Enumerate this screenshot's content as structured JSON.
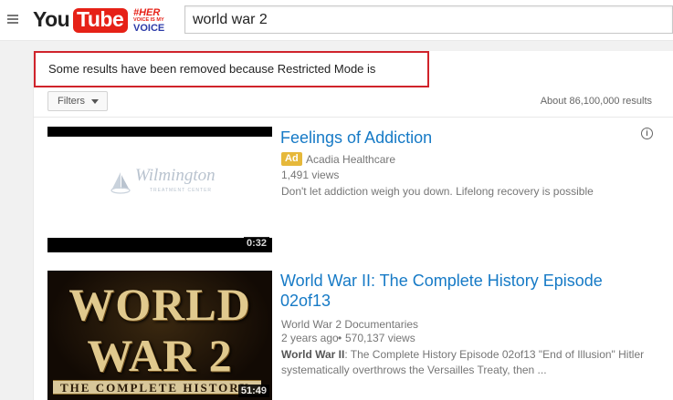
{
  "search": {
    "query": "world war 2"
  },
  "logo": {
    "you": "You",
    "tube": "Tube",
    "tag_line1": "#HER",
    "tag_line2": "VOICE IS MY",
    "tag_line3": "VOICE"
  },
  "notice": {
    "text": "Some results have been removed because Restricted Mode is enabled."
  },
  "filters": {
    "label": "Filters"
  },
  "results_count": "About 86,100,000 results",
  "results": [
    {
      "title": "Feelings of Addiction",
      "badge": "Ad",
      "channel": "Acadia Healthcare",
      "views": "1,491 views",
      "description": "Don't let addiction weigh you down. Lifelong recovery is possible",
      "duration": "0:32",
      "thumb_brand": "Wilmington",
      "thumb_sub": "TREATMENT CENTER"
    },
    {
      "title": "World War II: The Complete History Episode 02of13",
      "channel": "World War 2 Documentaries",
      "age": "2 years ago",
      "views": "570,137 views",
      "description_bold": "World War II",
      "description_rest": ": The Complete History Episode 02of13 \"End of Illusion\" Hitler systematically overthrows the Versailles Treaty, then ...",
      "duration": "51:49",
      "thumb_line1": "WORLD",
      "thumb_line2": "WAR 2",
      "thumb_band": "THE COMPLETE HISTORY"
    }
  ],
  "colors": {
    "accent_link": "#167ac6",
    "brand_red": "#e62117",
    "ad_badge": "#e6b83a",
    "notice_border": "#d0232b"
  }
}
